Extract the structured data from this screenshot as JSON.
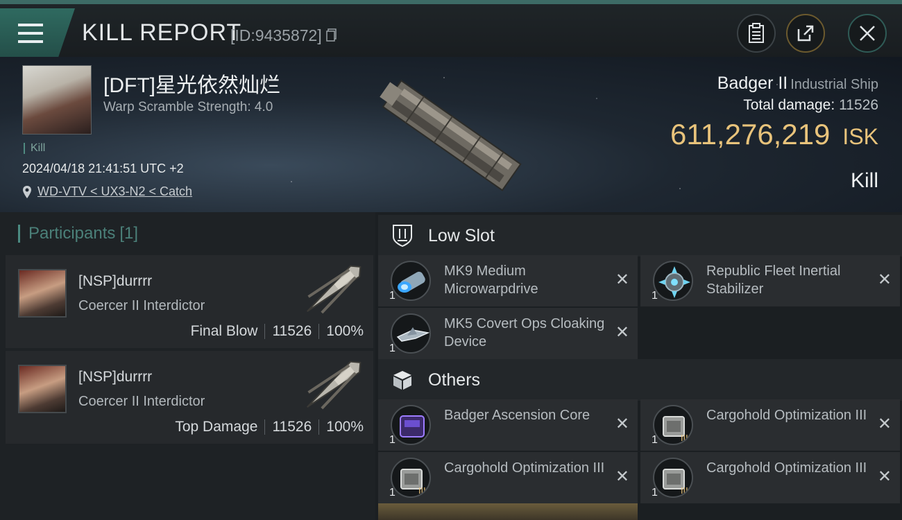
{
  "header": {
    "title": "KILL REPORT",
    "report_id": "[ID:9435872]"
  },
  "victim": {
    "name": "[DFT]星光依然灿烂",
    "warp_scramble": "Warp Scramble Strength: 4.0",
    "tag": "Kill",
    "time": "2024/04/18 21:41:51 UTC +2",
    "location": "WD-VTV < UX3-N2 < Catch"
  },
  "ship": {
    "name": "Badger II",
    "class": "Industrial Ship",
    "total_damage_label": "Total damage:",
    "total_damage": "11526",
    "isk_value": "611,276,219",
    "isk_unit": "ISK",
    "result": "Kill"
  },
  "participants": {
    "label": "Participants",
    "count": "[1]",
    "rows": [
      {
        "name": "[NSP]durrrr",
        "ship": "Coercer II Interdictor",
        "role": "Final Blow",
        "damage": "11526",
        "percent": "100%"
      },
      {
        "name": "[NSP]durrrr",
        "ship": "Coercer II Interdictor",
        "role": "Top Damage",
        "damage": "11526",
        "percent": "100%"
      }
    ]
  },
  "sections": {
    "low_slot": {
      "title": "Low Slot",
      "items": [
        {
          "name": "MK9 Medium Microwarpdrive",
          "qty": "1",
          "icon": "microwarpdrive-icon"
        },
        {
          "name": "Republic Fleet Inertial Stabilizer",
          "qty": "1",
          "icon": "inertial-stabilizer-icon"
        },
        {
          "name": "MK5 Covert Ops Cloaking Device",
          "qty": "1",
          "icon": "cloaking-device-icon"
        }
      ]
    },
    "others": {
      "title": "Others",
      "items": [
        {
          "name": "Badger Ascension Core",
          "qty": "1",
          "icon": "ascension-core-icon"
        },
        {
          "name": "Cargohold Optimization III",
          "qty": "1",
          "icon": "cargohold-optimization-icon"
        },
        {
          "name": "Cargohold Optimization III",
          "qty": "1",
          "icon": "cargohold-optimization-icon"
        },
        {
          "name": "Cargohold Optimization III",
          "qty": "1",
          "icon": "cargohold-optimization-icon"
        }
      ]
    }
  },
  "colors": {
    "accent_teal": "#3d6b66",
    "isk_gold": "#e8c37b"
  }
}
